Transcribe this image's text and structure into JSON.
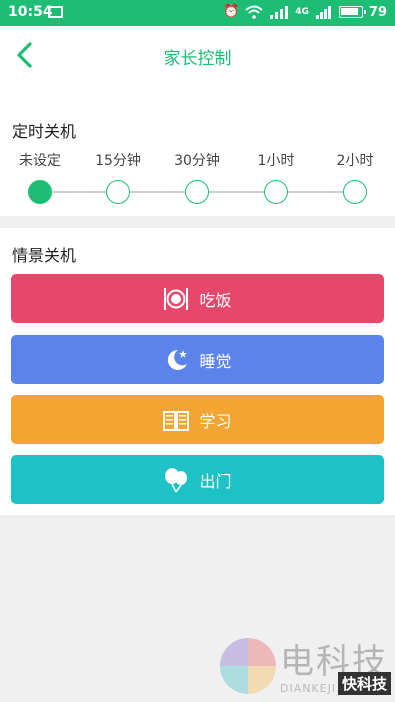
{
  "status_bar": {
    "time": "10:54",
    "battery": "79",
    "network_label": "4G"
  },
  "header": {
    "title": "家长控制"
  },
  "timer": {
    "title": "定时关机",
    "options": [
      "未设定",
      "15分钟",
      "30分钟",
      "1小时",
      "2小时"
    ],
    "selected_index": 0
  },
  "scene": {
    "title": "情景关机",
    "buttons": [
      {
        "label": "吃饭",
        "icon": "dining-icon",
        "color": "#e5486a"
      },
      {
        "label": "睡觉",
        "icon": "moon-icon",
        "color": "#5a84ea"
      },
      {
        "label": "学习",
        "icon": "book-icon",
        "color": "#f3a531"
      },
      {
        "label": "出门",
        "icon": "balloon-icon",
        "color": "#1cc2c5"
      }
    ]
  },
  "watermark": {
    "text": "电科技",
    "sub": "DIANKEJI.COM",
    "badge": "快科技"
  },
  "colors": {
    "accent": "#1dbe74"
  }
}
